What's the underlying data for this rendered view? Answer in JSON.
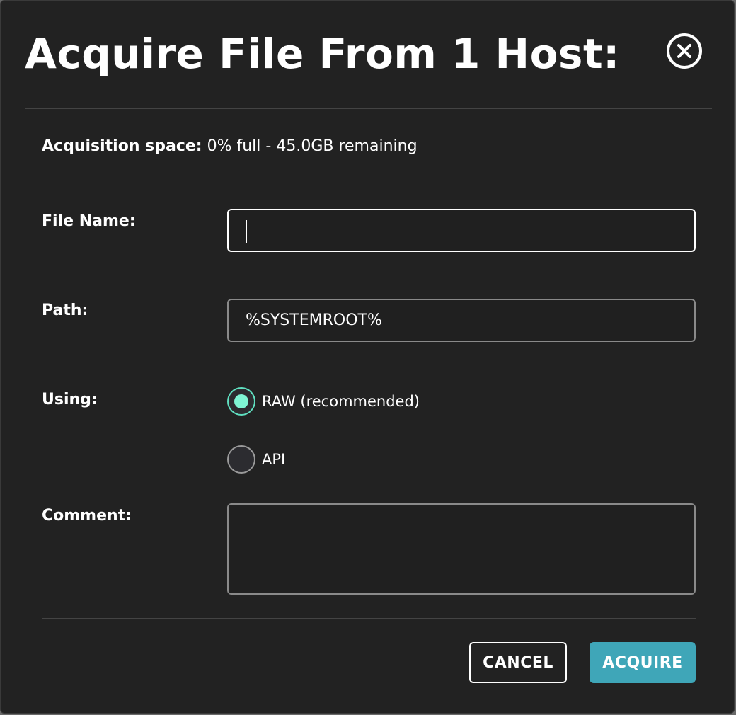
{
  "dialog": {
    "title": "Acquire File From 1 Host:",
    "space_label": "Acquisition space:",
    "space_value": " 0% full - 45.0GB remaining"
  },
  "form": {
    "file_name_label": "File Name:",
    "file_name_value": "",
    "path_label": "Path:",
    "path_value": "%SYSTEMROOT%",
    "using_label": "Using:",
    "using_options": [
      {
        "label": "RAW (recommended)",
        "selected": true
      },
      {
        "label": "API",
        "selected": false
      }
    ],
    "comment_label": "Comment:",
    "comment_value": ""
  },
  "actions": {
    "cancel_label": "CANCEL",
    "acquire_label": "ACQUIRE"
  },
  "icons": {
    "close": "close-circle-icon"
  },
  "colors": {
    "background": "#222222",
    "accent": "#3fa6b8",
    "radio_selected": "#7ff5d4"
  }
}
